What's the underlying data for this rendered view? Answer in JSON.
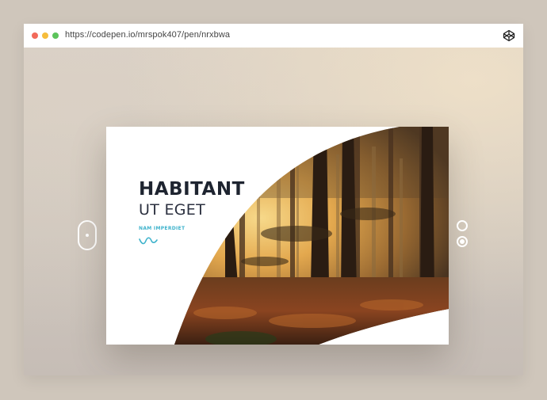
{
  "browser": {
    "url": "https://codepen.io/mrspok407/pen/nrxbwa"
  },
  "slide": {
    "title": "HABITANT",
    "subtitle": "UT EGET",
    "tag": "NAM IMPERDIET"
  },
  "pager": {
    "count": 2,
    "active_index": 1
  },
  "colors": {
    "accent": "#3fb3cc",
    "title": "#1e2430",
    "dribbble": "#ea4c89",
    "twitter": "#1da1f2"
  },
  "icons": {
    "address_bar_right": "codepen-icon",
    "bottom_left": "dribbble-icon",
    "bottom_right": "twitter-icon",
    "prev": "slider-prev-icon"
  }
}
